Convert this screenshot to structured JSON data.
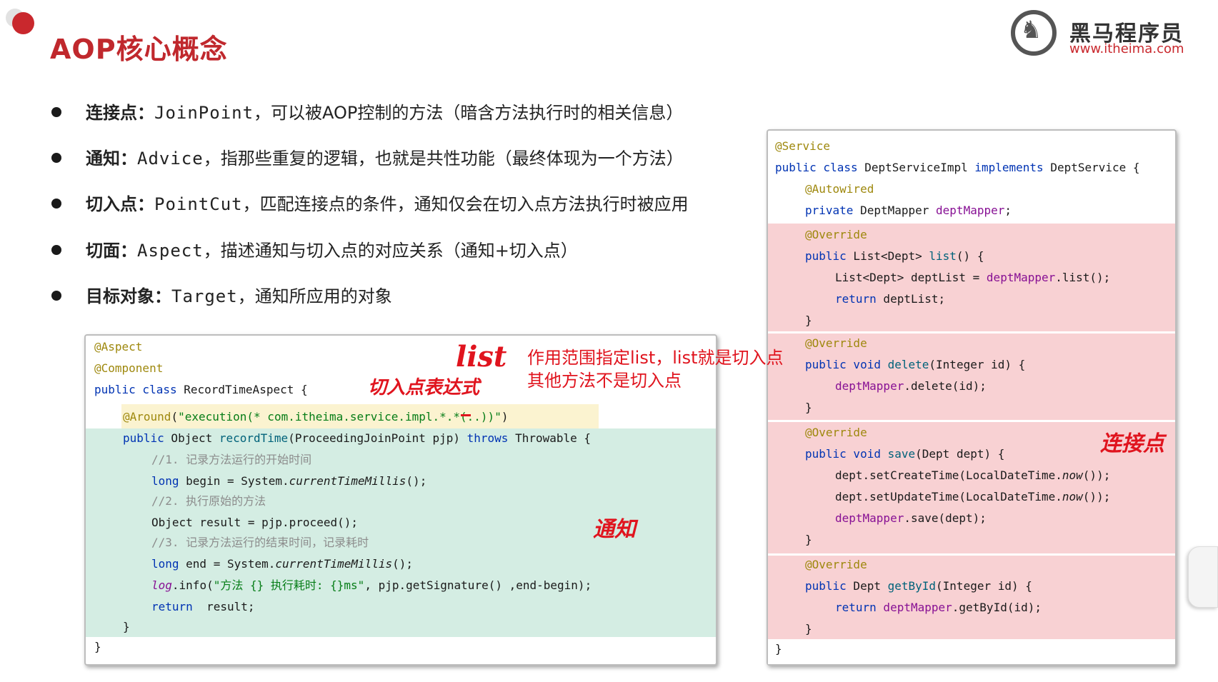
{
  "title": "AOP核心概念",
  "logo": {
    "name": "黑马程序员",
    "url": "www.itheima.com"
  },
  "bullets": [
    {
      "term": "连接点：",
      "mono": "JoinPoint",
      "desc": "，可以被AOP控制的方法（暗含方法执行时的相关信息）"
    },
    {
      "term": "通知：",
      "mono": "Advice",
      "desc": "，指那些重复的逻辑，也就是共性功能（最终体现为一个方法）"
    },
    {
      "term": "切入点：",
      "mono": "PointCut",
      "desc": "，匹配连接点的条件，通知仅会在切入点方法执行时被应用"
    },
    {
      "term": "切面：",
      "mono": "Aspect",
      "desc": "，描述通知与切入点的对应关系（通知+切入点）"
    },
    {
      "term": "目标对象：",
      "mono": "Target",
      "desc": "，通知所应用的对象"
    }
  ],
  "left_code": {
    "l1": "@Aspect",
    "l2": "@Component",
    "l3_kw": "public class",
    "l3_rest": " RecordTimeAspect {",
    "l4_ann": "@Around",
    "l4_str": "\"execution(* com.itheima.service.impl.*.*(..))\"",
    "l5_kw": "public",
    "l5_a": " Object ",
    "l5_m": "recordTime",
    "l5_b": "(ProceedingJoinPoint pjp) ",
    "l5_kw2": "throws",
    "l5_c": " Throwable {",
    "l6": "//1. 记录方法运行的开始时间",
    "l7_kw": "long",
    "l7_a": " begin = System.",
    "l7_i": "currentTimeMillis",
    "l7_b": "();",
    "l8": "//2. 执行原始的方法",
    "l9": "Object result = pjp.proceed();",
    "l10": "//3. 记录方法运行的结束时间，记录耗时",
    "l11_kw": "long",
    "l11_a": " end = System.",
    "l11_i": "currentTimeMillis",
    "l11_b": "();",
    "l12_i": "log",
    "l12_a": ".info(",
    "l12_s": "\"方法 {} 执行耗时: {}ms\"",
    "l12_b": ", pjp.getSignature() ,end-begin);",
    "l13_kw": "return",
    "l13_a": "  result;",
    "l14": "}",
    "l15": "}"
  },
  "right_code": {
    "r1": "@Service",
    "r2_kw": "public class",
    "r2_a": " DeptServiceImpl ",
    "r2_kw2": "implements",
    "r2_b": " DeptService {",
    "r3": "@Autowired",
    "r4_kw": "private",
    "r4_a": " DeptMapper ",
    "r4_f": "deptMapper",
    "r4_b": ";",
    "r5": "@Override",
    "r6_kw": "public",
    "r6_a": " List<Dept> ",
    "r6_m": "list",
    "r6_b": "() {",
    "r7_a": "List<Dept> deptList = ",
    "r7_f": "deptMapper",
    "r7_b": ".list();",
    "r8_kw": "return",
    "r8_a": " deptList;",
    "r9": "}",
    "r10": "@Override",
    "r11_kw": "public void",
    "r11_m": " delete",
    "r11_a": "(Integer id) {",
    "r12_f": "deptMapper",
    "r12_a": ".delete(id);",
    "r13": "}",
    "r14": "@Override",
    "r15_kw": "public void",
    "r15_m": " save",
    "r15_a": "(Dept dept) {",
    "r16_a": "dept.setCreateTime(LocalDateTime.",
    "r16_i": "now",
    "r16_b": "());",
    "r17_a": "dept.setUpdateTime(LocalDateTime.",
    "r17_i": "now",
    "r17_b": "());",
    "r18_f": "deptMapper",
    "r18_a": ".save(dept);",
    "r19": "}",
    "r20": "@Override",
    "r21_kw": "public",
    "r21_a": " Dept ",
    "r21_m": "getById",
    "r21_b": "(Integer id) {",
    "r22_kw": "return",
    "r22_f": " deptMapper",
    "r22_a": ".getById(id);",
    "r23": "}",
    "r24": "}"
  },
  "annotations": {
    "note_line1": "作用范围指定list，list就是切入点",
    "note_line2": "其他方法不是切入点",
    "hand_list": "list",
    "hand_pointcut_expr": "切入点表达式",
    "hand_advice": "通知",
    "hand_joinpoint": "连接点"
  },
  "colors": {
    "title_red": "#c0282d",
    "annotation_red": "#e0141e",
    "advice_highlight": "#d4ede3",
    "joinpoint_highlight": "#f8d1d3",
    "pointcut_highlight": "#fbf3d0"
  }
}
